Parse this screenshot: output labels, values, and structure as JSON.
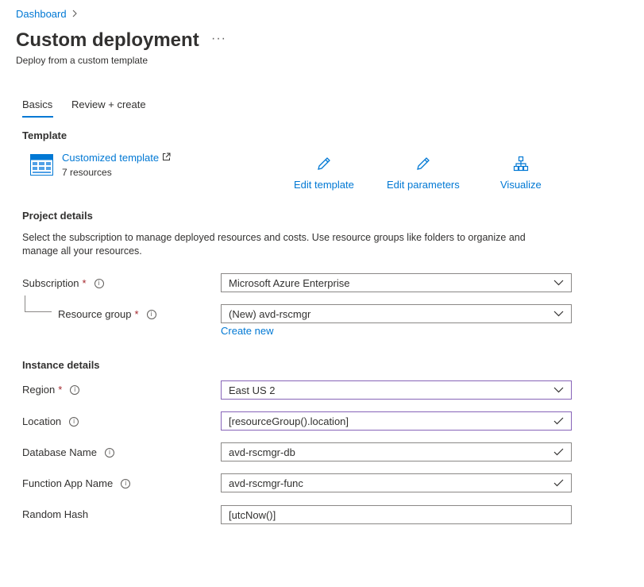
{
  "breadcrumb": {
    "items": [
      "Dashboard"
    ]
  },
  "header": {
    "title": "Custom deployment",
    "more": "···",
    "subtitle": "Deploy from a custom template"
  },
  "tabs": [
    {
      "label": "Basics",
      "selected": true
    },
    {
      "label": "Review + create",
      "selected": false
    }
  ],
  "template": {
    "heading": "Template",
    "link_label": "Customized template",
    "resource_count": "7 resources",
    "actions": [
      {
        "label": "Edit template",
        "icon": "pencil-icon"
      },
      {
        "label": "Edit parameters",
        "icon": "pencil-icon"
      },
      {
        "label": "Visualize",
        "icon": "hierarchy-icon"
      }
    ]
  },
  "project": {
    "heading": "Project details",
    "description": "Select the subscription to manage deployed resources and costs. Use resource groups like folders to organize and manage all your resources.",
    "subscription": {
      "label": "Subscription",
      "required": "*",
      "value": "Microsoft Azure Enterprise"
    },
    "resource_group": {
      "label": "Resource group",
      "required": "*",
      "value": "(New) avd-rscmgr",
      "create_new": "Create new"
    }
  },
  "instance": {
    "heading": "Instance details",
    "region": {
      "label": "Region",
      "required": "*",
      "value": "East US 2"
    },
    "location": {
      "label": "Location",
      "value": "[resourceGroup().location]"
    },
    "database_name": {
      "label": "Database Name",
      "value": "avd-rscmgr-db"
    },
    "function_app_name": {
      "label": "Function App Name",
      "value": "avd-rscmgr-func"
    },
    "random_hash": {
      "label": "Random Hash",
      "value": "[utcNow()]"
    }
  },
  "colors": {
    "accent": "#0078d4",
    "required": "#a4262c",
    "focus_border": "#8764b8",
    "check": "#323130"
  }
}
